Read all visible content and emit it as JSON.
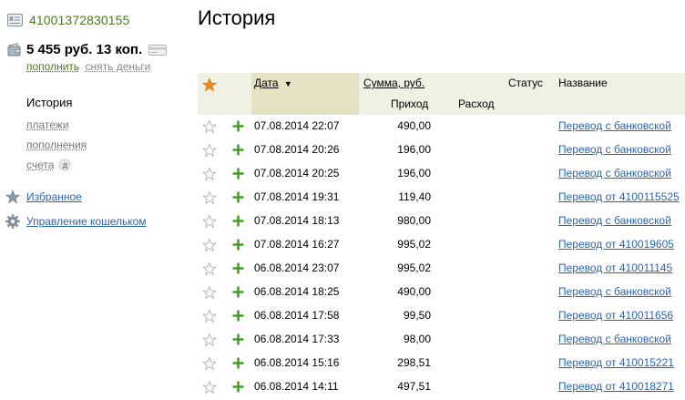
{
  "account": {
    "number": "41001372830155",
    "balance": "5 455 руб. 13 коп.",
    "topup_label": "пополнить",
    "withdraw_label": "снять деньги"
  },
  "nav": {
    "active": "История",
    "items": [
      "платежи",
      "пополнения",
      "счета"
    ],
    "badge": "д"
  },
  "links": {
    "favorites": "Избранное",
    "manage": "Управление кошельком"
  },
  "page": {
    "title": "История"
  },
  "table": {
    "headers": {
      "date": "Дата",
      "sort_arrow": "▼",
      "amount": "Сумма, руб.",
      "status": "Статус",
      "name": "Название",
      "income": "Приход",
      "expense": "Расход"
    },
    "rows": [
      {
        "date": "07.08.2014 22:07",
        "amount": "490,00",
        "name": "Перевод с банковской"
      },
      {
        "date": "07.08.2014 20:26",
        "amount": "196,00",
        "name": "Перевод с банковской"
      },
      {
        "date": "07.08.2014 20:25",
        "amount": "196,00",
        "name": "Перевод с банковской"
      },
      {
        "date": "07.08.2014 19:31",
        "amount": "119,40",
        "name": "Перевод от 4100115525"
      },
      {
        "date": "07.08.2014 18:13",
        "amount": "980,00",
        "name": "Перевод с банковской"
      },
      {
        "date": "07.08.2014 16:27",
        "amount": "995,02",
        "name": "Перевод от 410019605"
      },
      {
        "date": "06.08.2014 23:07",
        "amount": "995,02",
        "name": "Перевод от 410011145"
      },
      {
        "date": "06.08.2014 18:25",
        "amount": "490,00",
        "name": "Перевод с банковской"
      },
      {
        "date": "06.08.2014 17:58",
        "amount": "99,50",
        "name": "Перевод от 410011656"
      },
      {
        "date": "06.08.2014 17:33",
        "amount": "98,00",
        "name": "Перевод с банковской"
      },
      {
        "date": "06.08.2014 15:16",
        "amount": "298,51",
        "name": "Перевод от 410015221"
      },
      {
        "date": "06.08.2014 14:11",
        "amount": "497,51",
        "name": "Перевод от 410018271"
      }
    ]
  },
  "colors": {
    "green": "#4a7a1e",
    "link": "#2a63b3",
    "header_bg": "#f1f0e4",
    "sorted_header_bg": "#e5e1c3",
    "plus": "#3d9a1f",
    "star_active": "#f08a1c"
  },
  "icons": {
    "account": "account-card-icon",
    "wallet": "wallet-icon",
    "card": "bank-card-icon",
    "favorites": "star-icon",
    "manage": "gear-icon",
    "row_star": "star-outline-icon",
    "row_plus": "plus-icon"
  }
}
